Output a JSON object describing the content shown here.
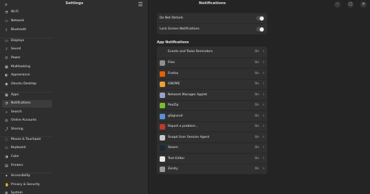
{
  "sidebar": {
    "title": "Settings",
    "items": [
      {
        "label": "Wi-Fi",
        "icon": "wifi-icon",
        "glyph": "◔"
      },
      {
        "label": "Network",
        "icon": "network-icon",
        "glyph": "▭"
      },
      {
        "label": "Bluetooth",
        "icon": "bluetooth-icon",
        "glyph": "ᛒ"
      },
      {
        "label": "Displays",
        "icon": "display-icon",
        "glyph": "▭"
      },
      {
        "label": "Sound",
        "icon": "sound-icon",
        "glyph": "♪"
      },
      {
        "label": "Power",
        "icon": "power-icon",
        "glyph": "⏻"
      },
      {
        "label": "Multitasking",
        "icon": "multitasking-icon",
        "glyph": "▦"
      },
      {
        "label": "Appearance",
        "icon": "appearance-icon",
        "glyph": "◐"
      },
      {
        "label": "Ubuntu Desktop",
        "icon": "ubuntu-desktop-icon",
        "glyph": "◉"
      },
      {
        "label": "Apps",
        "icon": "apps-icon",
        "glyph": "▦"
      },
      {
        "label": "Notifications",
        "icon": "bell-icon",
        "glyph": "◔"
      },
      {
        "label": "Search",
        "icon": "search-icon",
        "glyph": "⌕"
      },
      {
        "label": "Online Accounts",
        "icon": "online-accounts-icon",
        "glyph": "◎"
      },
      {
        "label": "Sharing",
        "icon": "sharing-icon",
        "glyph": "⤴"
      },
      {
        "label": "Mouse & Touchpad",
        "icon": "mouse-icon",
        "glyph": "◌"
      },
      {
        "label": "Keyboard",
        "icon": "keyboard-icon",
        "glyph": "▭"
      },
      {
        "label": "Color",
        "icon": "color-icon",
        "glyph": "◑"
      },
      {
        "label": "Printers",
        "icon": "printer-icon",
        "glyph": "▤"
      },
      {
        "label": "Accessibility",
        "icon": "accessibility-icon",
        "glyph": "✦"
      },
      {
        "label": "Privacy & Security",
        "icon": "privacy-icon",
        "glyph": "✋"
      },
      {
        "label": "System",
        "icon": "system-icon",
        "glyph": "⚙"
      }
    ],
    "active": "Notifications"
  },
  "main": {
    "title": "Notifications",
    "general": [
      {
        "label": "Do Not Disturb",
        "state": "off"
      },
      {
        "label": "Lock Screen Notifications",
        "state": "off"
      }
    ],
    "apps_heading": "App Notifications",
    "apps": [
      {
        "label": "Events and Tasks Reminders",
        "state": "On",
        "icon": "reminders-icon",
        "color": "#2e2e2e"
      },
      {
        "label": "Files",
        "state": "On",
        "icon": "files-icon",
        "color": "#8f8f8f"
      },
      {
        "label": "Firefox",
        "state": "On",
        "icon": "firefox-icon",
        "color": "#e66000"
      },
      {
        "label": "GNOME",
        "state": "On",
        "icon": "gnome-icon",
        "color": "#f0a030"
      },
      {
        "label": "Network Manager Applet",
        "state": "On",
        "icon": "network-applet-icon",
        "color": "#9aa0c8"
      },
      {
        "label": "PeaZip",
        "state": "On",
        "icon": "peazip-icon",
        "color": "#7cbf2a"
      },
      {
        "label": "gSignond",
        "state": "On",
        "icon": "gsignond-icon",
        "color": "#5c8fd6"
      },
      {
        "label": "Report a problem...",
        "state": "On",
        "icon": "report-problem-icon",
        "color": "#c0392b"
      },
      {
        "label": "Snapd User Session Agent",
        "state": "On",
        "icon": "snapd-icon",
        "color": "#c8c8c8"
      },
      {
        "label": "Steam",
        "state": "On",
        "icon": "steam-icon",
        "color": "#1b2838"
      },
      {
        "label": "Text Editor",
        "state": "On",
        "icon": "text-editor-icon",
        "color": "#e8e8e8"
      },
      {
        "label": "Zenity",
        "state": "On",
        "icon": "zenity-icon",
        "color": "#9a9a9a"
      }
    ]
  },
  "window": {
    "minimize": "–",
    "maximize": "□",
    "close": "×"
  }
}
